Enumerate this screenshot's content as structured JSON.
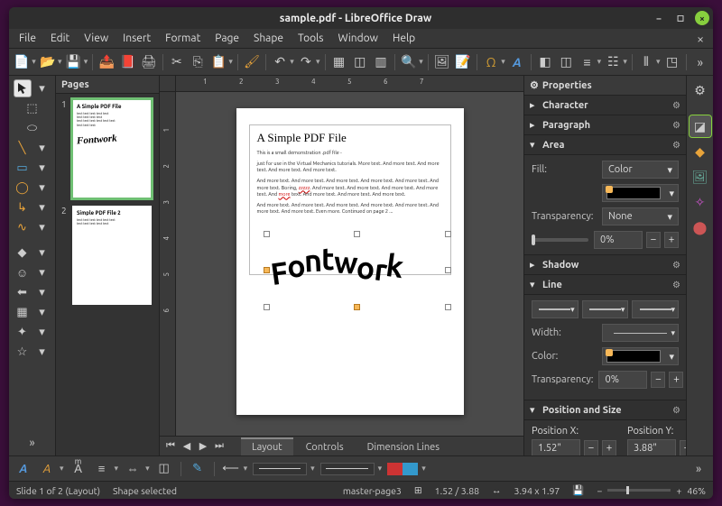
{
  "window": {
    "title": "sample.pdf - LibreOffice Draw"
  },
  "menu": [
    "File",
    "Edit",
    "View",
    "Insert",
    "Format",
    "Page",
    "Shape",
    "Tools",
    "Window",
    "Help"
  ],
  "pages_panel": {
    "title": "Pages"
  },
  "thumbs": [
    {
      "num": "1",
      "title": "A Simple PDF File",
      "fw": "Fontwork"
    },
    {
      "num": "2",
      "title": "Simple PDF File 2"
    }
  ],
  "doc": {
    "heading": "A Simple PDF File",
    "p1": "This is a small demonstration .pdf file -",
    "p2": "just for use in the Virtual Mechanics tutorials. More text. And more text. And more text. And more text. And more text.",
    "p3": "And more text. And more text. And more text. And more text. And more text. And more text. Boring, zzzzz. And more text. And more text. And more text. And more text. And more text. And more text. And more text. And more text. And more text.",
    "p4": "And more text. And more text. And more text. And more text. And more text. And more text. And more text. Even more. Continued on page 2 ...",
    "fontwork": "Fontwork"
  },
  "bottom_tabs": {
    "layout": "Layout",
    "controls": "Controls",
    "dimension": "Dimension Lines"
  },
  "props": {
    "title": "Properties",
    "character": "Character",
    "paragraph": "Paragraph",
    "area": "Area",
    "fill_label": "Fill:",
    "fill_value": "Color",
    "transp_label": "Transparency:",
    "transp_value": "None",
    "transp_pct": "0%",
    "shadow": "Shadow",
    "line": "Line",
    "width_label": "Width:",
    "color_label": "Color:",
    "line_transp_label": "Transparency:",
    "line_transp_value": "0%",
    "possize": "Position and Size",
    "posx_label": "Position X:",
    "posy_label": "Position Y:",
    "posx_value": "1.52\"",
    "posy_value": "3.88\""
  },
  "status": {
    "slide": "Slide 1 of 2 (Layout)",
    "selection": "Shape selected",
    "master": "master-page3",
    "ratio_icon": "⊞",
    "pos": "1.52 / 3.88",
    "size_icon": "↔",
    "size": "3.94 x 1.97",
    "zoom": "46%"
  },
  "hruler": [
    "1",
    "2",
    "3",
    "4",
    "5",
    "6",
    "7"
  ],
  "vruler": [
    "1",
    "2",
    "3",
    "4",
    "5",
    "6"
  ]
}
